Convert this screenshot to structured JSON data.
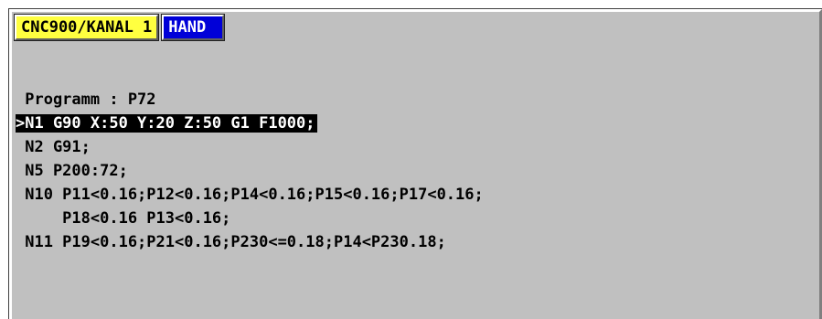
{
  "header": {
    "channel_label": "CNC900/KANAL 1",
    "mode_label": "HAND"
  },
  "program": {
    "title_prefix": " Programm : P72",
    "lines": [
      ">N1 G90 X:50 Y:20 Z:50 G1 F1000;",
      " N2 G91;",
      " N5 P200:72;",
      " N10 P11<0.16;P12<0.16;P14<0.16;P15<0.16;P17<0.16;",
      "     P18<0.16 P13<0.16;",
      " N11 P19<0.16;P21<0.16;P230<=0.18;P14<P230.18;"
    ],
    "selected_index": 0
  },
  "colors": {
    "panel_background": "#c0c0c0",
    "channel_badge": "#ffff40",
    "mode_badge": "#0000d8",
    "selection": "#000000"
  }
}
